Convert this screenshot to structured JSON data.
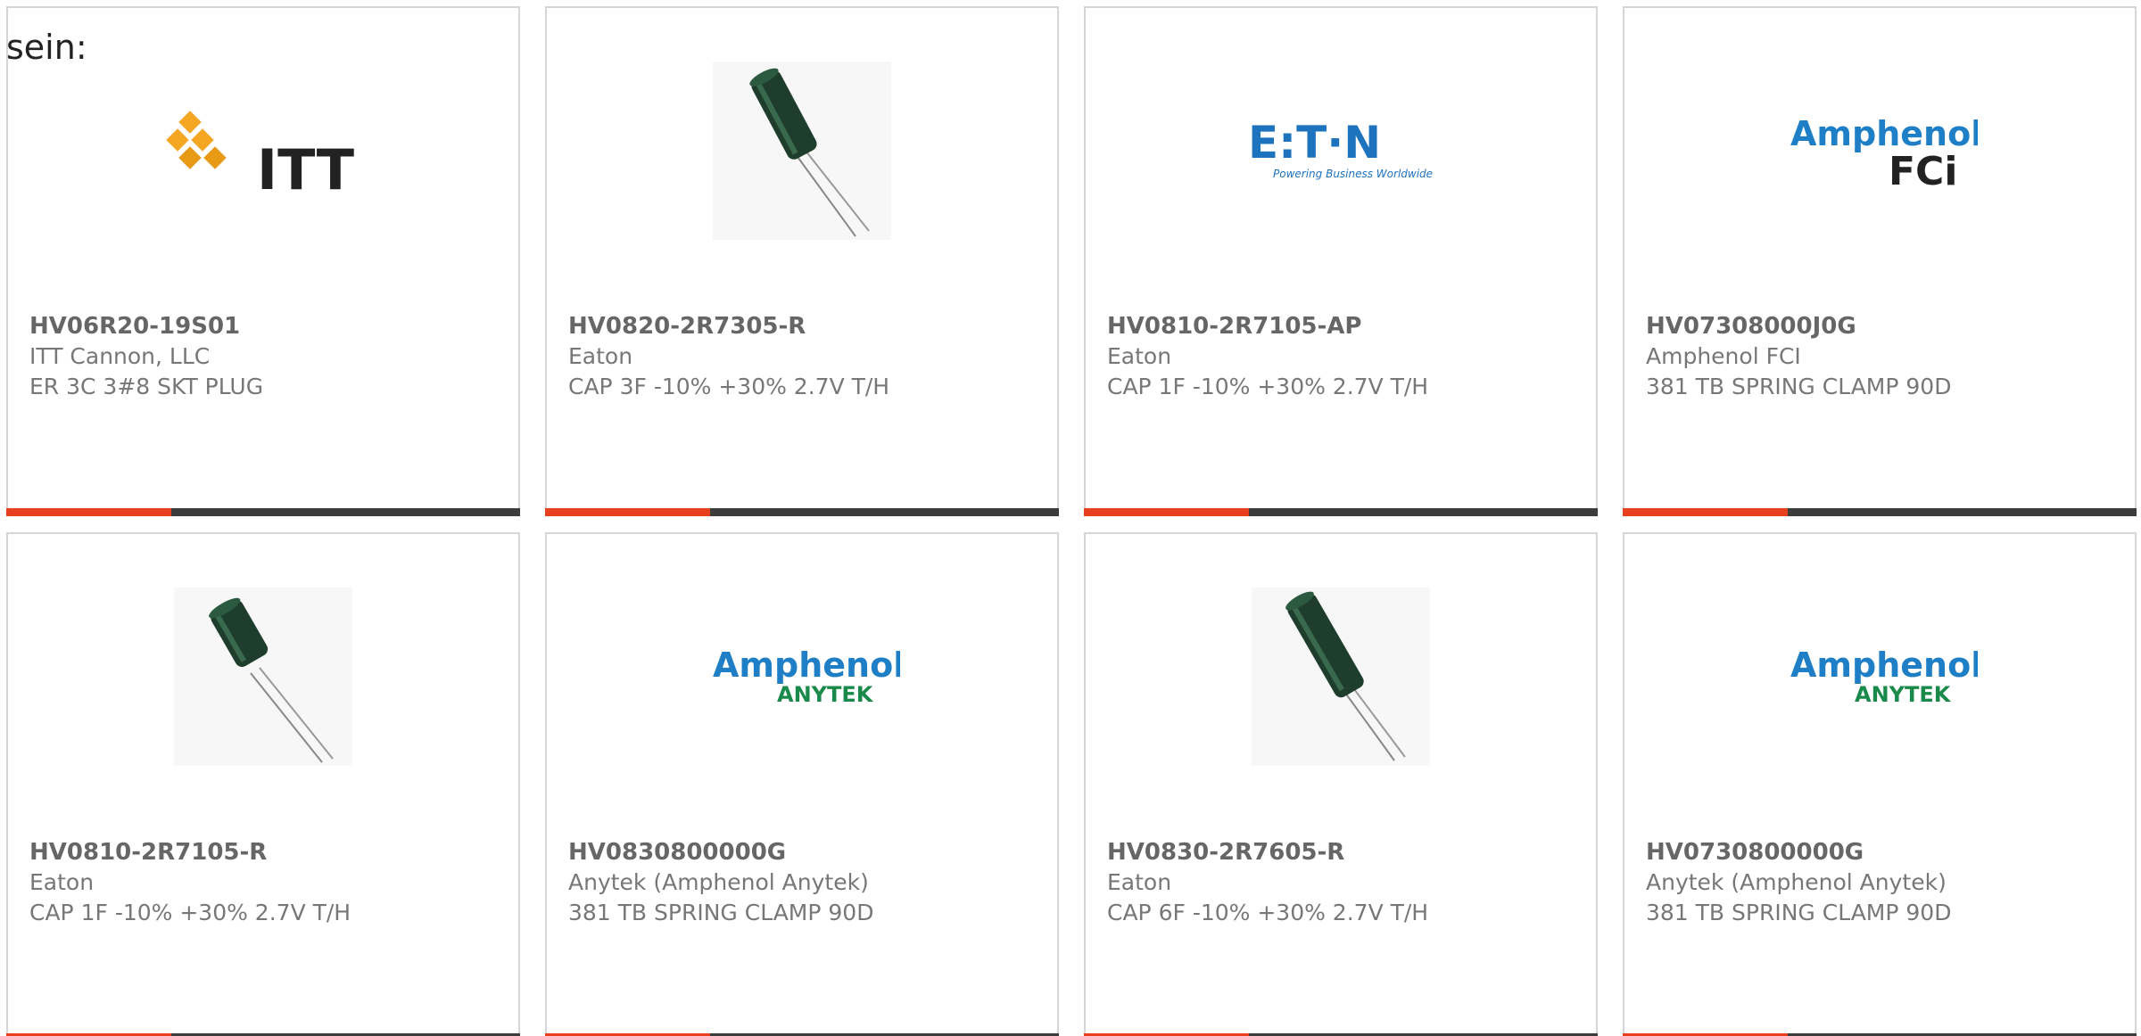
{
  "intro_text": "sein:",
  "colors": {
    "accent": "#e8401c",
    "bar": "#3c3c3c",
    "border": "#d6d6d6",
    "eaton_blue": "#1e73be",
    "amphenol_blue": "#1e7fc6",
    "anytek_green": "#1a8a4a",
    "itt_orange": "#f5a623"
  },
  "cards": [
    {
      "part_number": "HV06R20-19S01",
      "manufacturer": "ITT Cannon, LLC",
      "description": "ER 3C 3#8 SKT PLUG",
      "image": "itt-logo",
      "logo_text": "ITT"
    },
    {
      "part_number": "HV0820-2R7305-R",
      "manufacturer": "Eaton",
      "description": "CAP 3F -10% +30% 2.7V T/H",
      "image": "capacitor-photo"
    },
    {
      "part_number": "HV0810-2R7105-AP",
      "manufacturer": "Eaton",
      "description": "CAP 1F -10% +30% 2.7V T/H",
      "image": "eaton-logo",
      "logo_text": "E:T·N",
      "logo_tagline": "Powering Business Worldwide"
    },
    {
      "part_number": "HV07308000J0G",
      "manufacturer": "Amphenol FCI",
      "description": "381 TB SPRING CLAMP 90D",
      "image": "amphenol-fci-logo",
      "logo_text": "Amphenol",
      "logo_sub": "FCi"
    },
    {
      "part_number": "HV0810-2R7105-R",
      "manufacturer": "Eaton",
      "description": "CAP 1F -10% +30% 2.7V T/H",
      "image": "capacitor-photo"
    },
    {
      "part_number": "HV0830800000G",
      "manufacturer": "Anytek (Amphenol Anytek)",
      "description": "381 TB SPRING CLAMP 90D",
      "image": "amphenol-anytek-logo",
      "logo_text": "Amphenol",
      "logo_sub": "ANYTEK"
    },
    {
      "part_number": "HV0830-2R7605-R",
      "manufacturer": "Eaton",
      "description": "CAP 6F -10% +30% 2.7V T/H",
      "image": "capacitor-photo"
    },
    {
      "part_number": "HV0730800000G",
      "manufacturer": "Anytek (Amphenol Anytek)",
      "description": "381 TB SPRING CLAMP 90D",
      "image": "amphenol-anytek-logo",
      "logo_text": "Amphenol",
      "logo_sub": "ANYTEK"
    }
  ]
}
